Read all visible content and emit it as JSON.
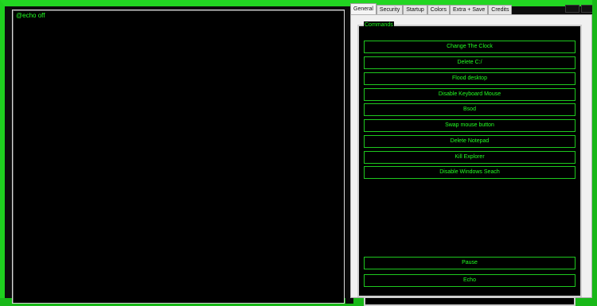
{
  "editor": {
    "content": "@echo off"
  },
  "tabs": [
    "General",
    "Security",
    "Startup",
    "Colors",
    "Extra + Save",
    "Credits"
  ],
  "commands": {
    "group_label": "Commands",
    "buttons": [
      "Change The Clock",
      "Delete C:/",
      "Flood desktop",
      "Disable Keyboard  Mouse",
      "Bsod",
      "Swap mouse button",
      "Delete Notepad",
      "Kill Explorer",
      "Disable Windows Seach"
    ],
    "pause_label": "Pause",
    "echo_label": "Echo"
  },
  "colors": {
    "accent": "#22ff22",
    "frame": "#1fd11f",
    "background": "#000000"
  }
}
